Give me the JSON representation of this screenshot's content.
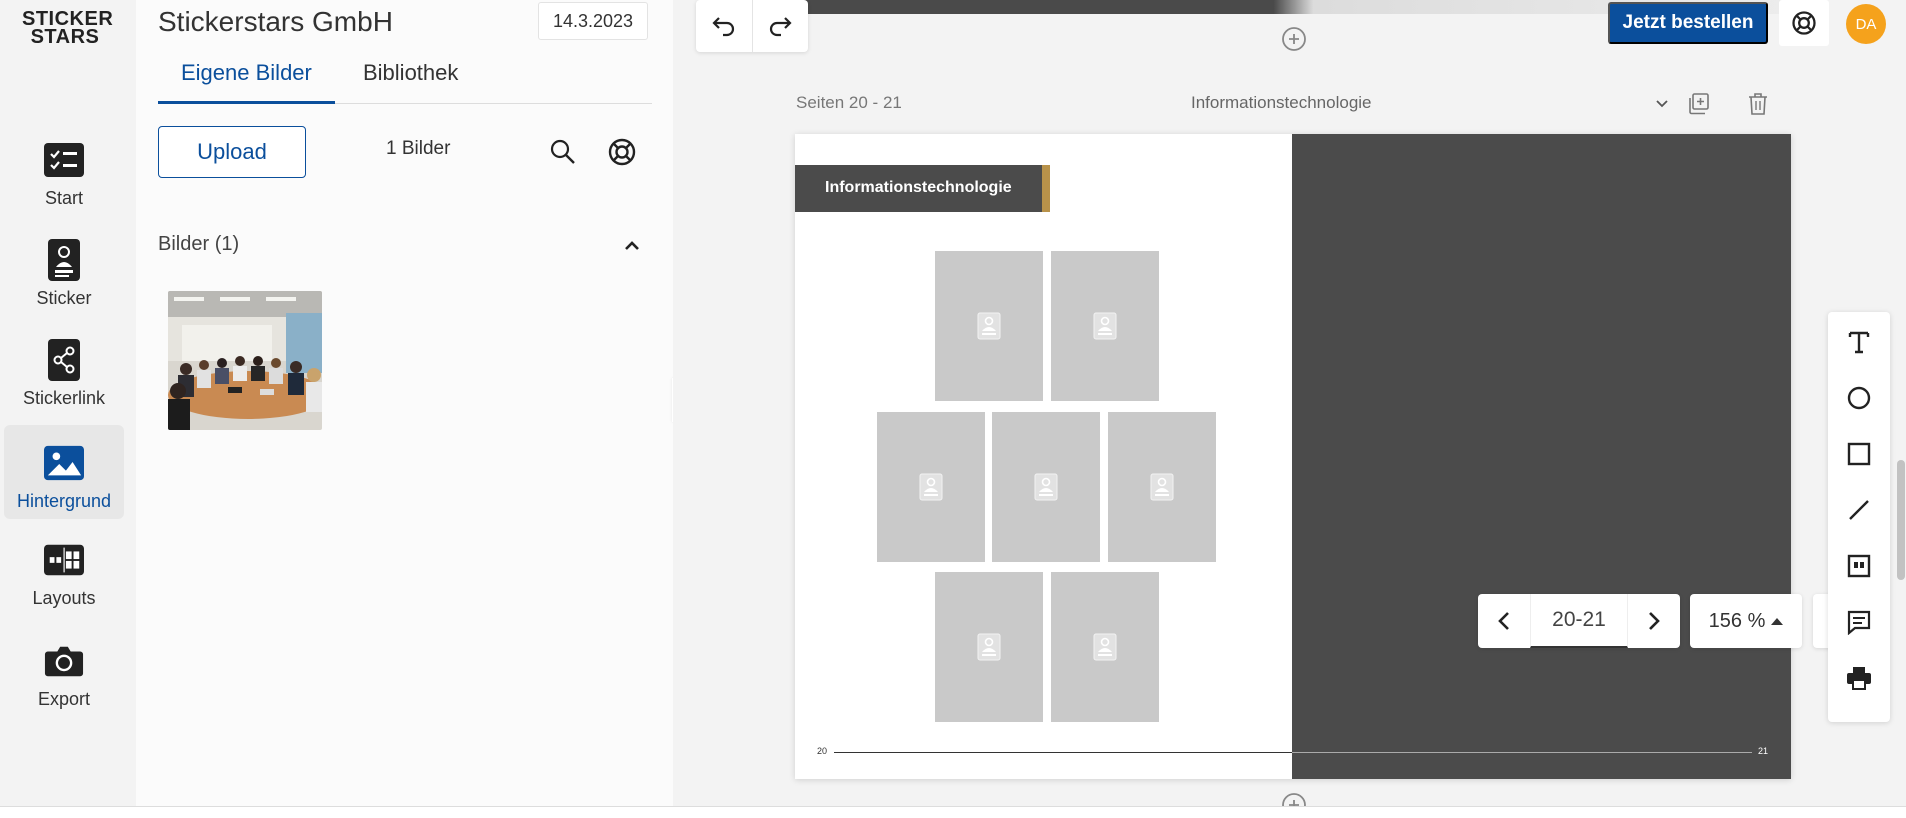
{
  "rail": {
    "logo": "STICKER STARS",
    "items": [
      {
        "label": "Start",
        "icon": "checklist-icon"
      },
      {
        "label": "Sticker",
        "icon": "sticker-icon"
      },
      {
        "label": "Stickerlink",
        "icon": "share-icon"
      },
      {
        "label": "Hintergrund",
        "icon": "image-icon"
      },
      {
        "label": "Layouts",
        "icon": "layouts-icon"
      },
      {
        "label": "Export",
        "icon": "camera-icon"
      }
    ],
    "active": "Hintergrund"
  },
  "panel": {
    "company": "Stickerstars GmbH",
    "date": "14.3.2023",
    "tabs": [
      {
        "label": "Eigene Bilder"
      },
      {
        "label": "Bibliothek"
      }
    ],
    "upload_label": "Upload",
    "count_label": "1 Bilder",
    "section_title": "Bilder (1)"
  },
  "header": {
    "order_label": "Jetzt bestellen",
    "avatar_initials": "DA",
    "accent_color": "#0b4f9c",
    "avatar_color": "#f5a21c"
  },
  "editor": {
    "pages_label": "Seiten 20 - 21",
    "theme": "Informationstechnologie",
    "page_title": "Informationstechnologie",
    "left_page_number": "20",
    "right_page_number": "21",
    "slot_count": 7
  },
  "pager": {
    "value": "20-21"
  },
  "zoom": {
    "value": "156 %"
  },
  "tools": [
    "text-tool-icon",
    "circle-tool-icon",
    "rectangle-tool-icon",
    "line-tool-icon",
    "frame-tool-icon",
    "comment-tool-icon",
    "print-icon"
  ]
}
